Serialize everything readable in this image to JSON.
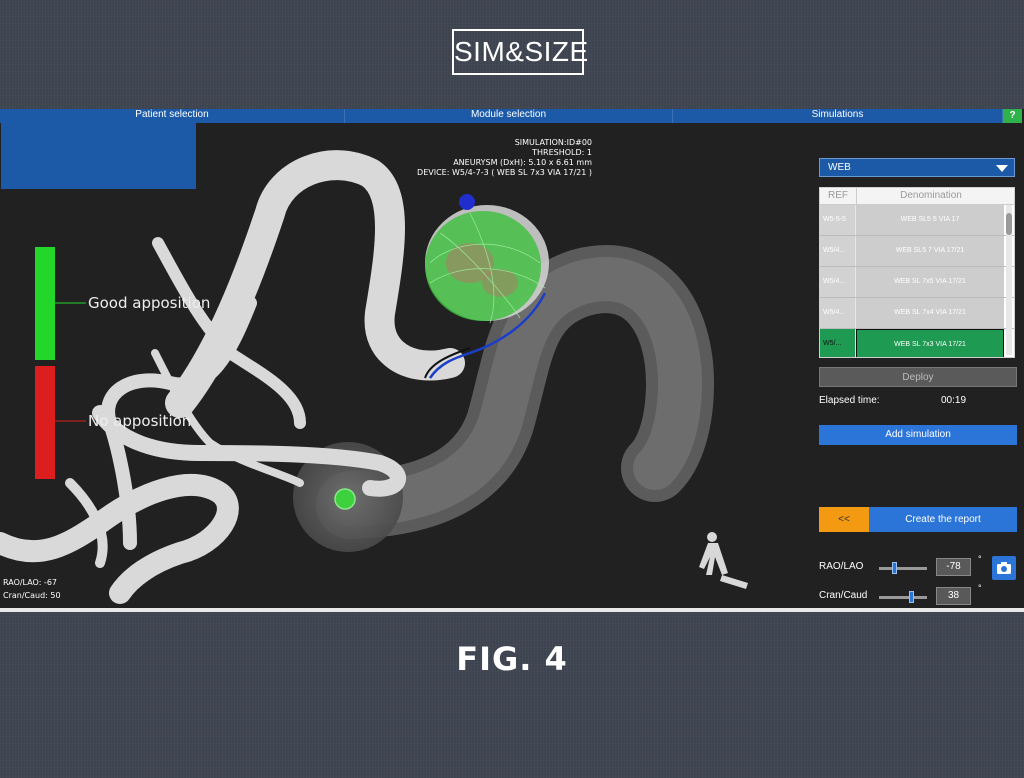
{
  "logo": {
    "text": "SIM&SIZE"
  },
  "figure_caption": "FIG. 4",
  "tabs": [
    {
      "label": "Patient selection"
    },
    {
      "label": "Module selection"
    },
    {
      "label": "Simulations"
    }
  ],
  "help_label": "?",
  "simulation_info": {
    "line1": "SIMULATION:ID#00",
    "line2": "THRESHOLD: 1",
    "line3": "ANEURYSM (DxH): 5.10 x 6.61 mm",
    "line4": "DEVICE: W5/4-7-3 ( WEB SL 7x3 VIA 17/21 )"
  },
  "legend": {
    "good": "Good apposition",
    "bad": "No apposition",
    "good_color": "#22d62a",
    "bad_color": "#dd1e1e"
  },
  "view_coords": {
    "rao_lao": "RAO/LAO: -67",
    "cran_caud": "Cran/Caud: 50"
  },
  "device_select": {
    "value": "WEB"
  },
  "device_table": {
    "headers": [
      "REF",
      "Denomination"
    ],
    "rows": [
      {
        "ref": "W5-5-5",
        "name": "WEB SL5 5 VIA 17",
        "selected": false
      },
      {
        "ref": "W5/4...",
        "name": "WEB SL5 7 VIA 17/21",
        "selected": false
      },
      {
        "ref": "W5/4...",
        "name": "WEB SL 7x5 VIA 17/21",
        "selected": false
      },
      {
        "ref": "W5/4...",
        "name": "WEB SL 7x4 VIA 17/21",
        "selected": false
      },
      {
        "ref": "W5/...",
        "name": "WEB SL 7x3 VIA 17/21",
        "selected": true
      }
    ]
  },
  "deploy_label": "Deploy",
  "elapsed": {
    "label": "Elapsed time:",
    "value": "00:19"
  },
  "add_simulation_label": "Add simulation",
  "back_label": "<<",
  "create_report_label": "Create the report",
  "sliders": {
    "rao_lao": {
      "label": "RAO/LAO",
      "value": "-78",
      "unit": "°",
      "level": 0.3
    },
    "cran_caud": {
      "label": "Cran/Caud",
      "value": "38",
      "unit": "°",
      "level": 0.7
    }
  },
  "colors": {
    "accent_blue": "#2b74d8",
    "tab_blue": "#1c5aa8",
    "selected_green": "#1e9a52",
    "back_orange": "#f39a12"
  },
  "icons": [
    "camera-icon",
    "chevron-down-icon",
    "patient-figure-icon",
    "help-icon"
  ]
}
